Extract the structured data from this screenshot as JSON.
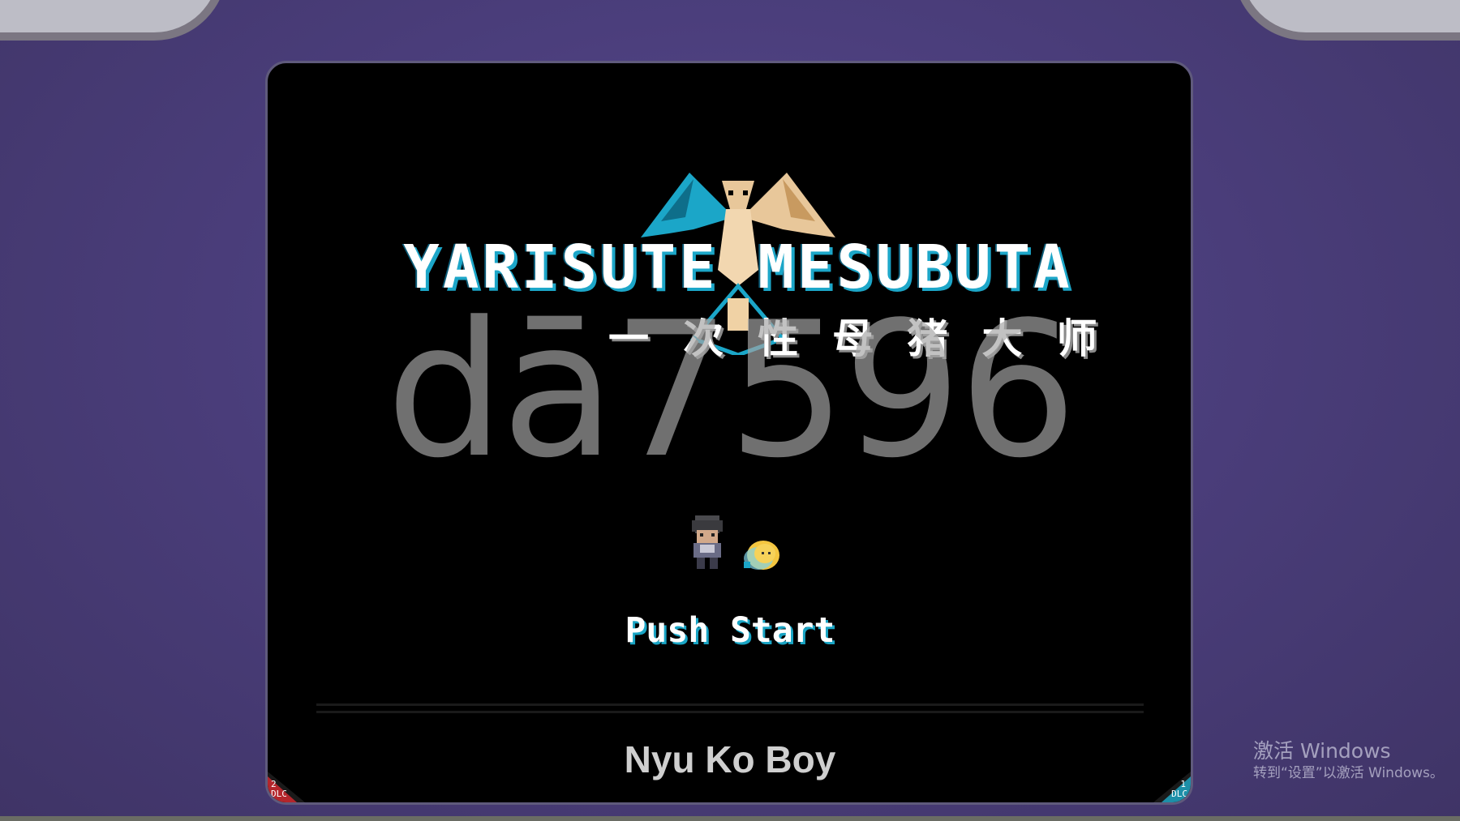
{
  "game": {
    "title_en": "YARISUTE MESUBUTA",
    "title_cn": "一 次 性 母 猪 大 师"
  },
  "watermark": {
    "text": "dā7596"
  },
  "screen": {
    "prompt": "Push Start",
    "console_label": "Nyu Ko Boy"
  },
  "badges": {
    "left": {
      "number": "2",
      "tag": "DLC",
      "color": "#b3262c"
    },
    "right": {
      "number": "1",
      "tag": "DLC",
      "color": "#1d8fa8"
    }
  },
  "windows_activation": {
    "line1": "激活 Windows",
    "line2": "转到“设置”以激活 Windows。"
  },
  "icons": [
    "dragon-logo-icon",
    "player-sprite-icon",
    "pet-sprite-icon"
  ],
  "colors": {
    "accent_cyan": "#1ca6c8",
    "background_purple": "#4b3e7c",
    "screen": "#000000"
  }
}
